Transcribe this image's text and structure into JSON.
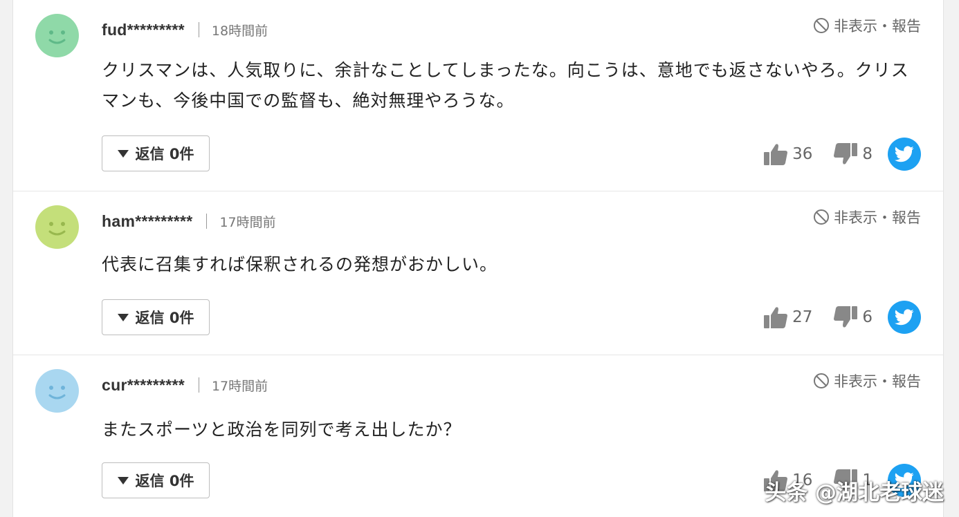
{
  "colors": {
    "avatar1": "#8fd9a8",
    "avatar2": "#c4df7a",
    "avatar3": "#a9d7f0",
    "twitter": "#1da1f2",
    "text": "#222222",
    "muted": "#666666"
  },
  "comments": [
    {
      "username": "fud*********",
      "time": "18時間前",
      "hide_report": "非表示・報告",
      "text": "クリスマンは、人気取りに、余計なことしてしまったな。向こうは、意地でも返さないやろ。クリスマンも、今後中国での監督も、絶対無理やろうな。",
      "reply_label": "返信 0件",
      "likes": "36",
      "dislikes": "8",
      "avatar_icon": "smiley-icon"
    },
    {
      "username": "ham*********",
      "time": "17時間前",
      "hide_report": "非表示・報告",
      "text": "代表に召集すれば保釈されるの発想がおかしい。",
      "reply_label": "返信 0件",
      "likes": "27",
      "dislikes": "6",
      "avatar_icon": "smiley-icon"
    },
    {
      "username": "cur*********",
      "time": "17時間前",
      "hide_report": "非表示・報告",
      "text": "またスポーツと政治を同列で考え出したか？",
      "reply_label": "返信 0件",
      "likes": "16",
      "dislikes": "1",
      "avatar_icon": "smiley-icon"
    }
  ],
  "watermark": "头条 @湖北老球迷"
}
